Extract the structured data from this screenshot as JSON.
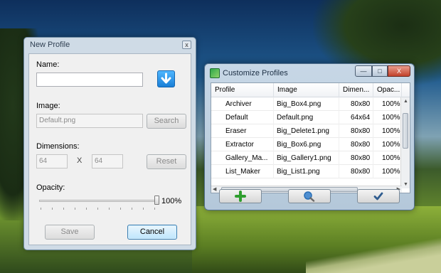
{
  "new_profile": {
    "title": "New Profile",
    "close_glyph": "x",
    "name_label": "Name:",
    "name_value": "",
    "download_icon": "download-arrow-icon",
    "image_label": "Image:",
    "image_value": "Default.png",
    "search_label": "Search",
    "dimensions_label": "Dimensions:",
    "width_value": "64",
    "x_label": "X",
    "height_value": "64",
    "reset_label": "Reset",
    "opacity_label": "Opacity:",
    "opacity_value": "100%",
    "opacity_fraction": 1.0,
    "save_label": "Save",
    "cancel_label": "Cancel"
  },
  "customize_profiles": {
    "title": "Customize Profiles",
    "caption_buttons": [
      "—",
      "□",
      "X"
    ],
    "columns": [
      "Profile",
      "Image",
      "Dimen...",
      "Opac..."
    ],
    "rows": [
      {
        "profile": "Archiver",
        "image": "Big_Box4.png",
        "dim": "80x80",
        "opacity": "100%"
      },
      {
        "profile": "Default",
        "image": "Default.png",
        "dim": "64x64",
        "opacity": "100%"
      },
      {
        "profile": "Eraser",
        "image": "Big_Delete1.png",
        "dim": "80x80",
        "opacity": "100%"
      },
      {
        "profile": "Extractor",
        "image": "Big_Box6.png",
        "dim": "80x80",
        "opacity": "100%"
      },
      {
        "profile": "Gallery_Ma...",
        "image": "Big_Gallery1.png",
        "dim": "80x80",
        "opacity": "100%"
      },
      {
        "profile": "List_Maker",
        "image": "Big_List1.png",
        "dim": "80x80",
        "opacity": "100%"
      }
    ],
    "toolbar_icons": [
      "add-plus-icon",
      "search-globe-icon",
      "checkmark-icon"
    ],
    "colors": {
      "add": "#2e9e2e",
      "search": "#2a6fb5",
      "check": "#2f5c8f"
    }
  }
}
